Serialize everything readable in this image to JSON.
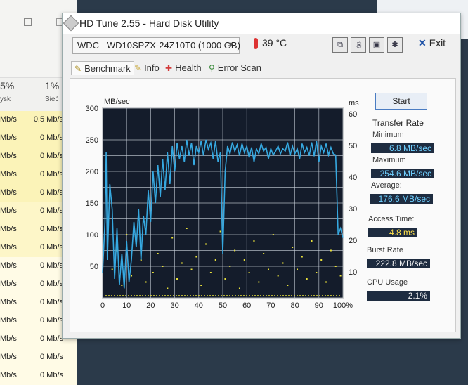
{
  "background_window": {
    "headers": [
      {
        "pct": "5%",
        "label": "ysk"
      },
      {
        "pct": "1%",
        "label": "Sieć"
      }
    ],
    "rows": [
      {
        "disk": "Mb/s",
        "net": "0,5 Mb/s"
      },
      {
        "disk": "Mb/s",
        "net": "0 Mb/s"
      },
      {
        "disk": "Mb/s",
        "net": "0 Mb/s"
      },
      {
        "disk": "Mb/s",
        "net": "0 Mb/s"
      },
      {
        "disk": "Mb/s",
        "net": "0 Mb/s"
      },
      {
        "disk": "Mb/s",
        "net": "0 Mb/s"
      },
      {
        "disk": "Mb/s",
        "net": "0 Mb/s"
      },
      {
        "disk": "Mb/s",
        "net": "0 Mb/s"
      },
      {
        "disk": "Mb/s",
        "net": "0 Mb/s"
      },
      {
        "disk": "Mb/s",
        "net": "0 Mb/s"
      },
      {
        "disk": "Mb/s",
        "net": "0 Mb/s"
      },
      {
        "disk": "Mb/s",
        "net": "0 Mb/s"
      },
      {
        "disk": "Mb/s",
        "net": "0 Mb/s"
      },
      {
        "disk": "Mb/s",
        "net": "0 Mb/s"
      },
      {
        "disk": "Mb/s",
        "net": "0 Mb/s"
      }
    ]
  },
  "window": {
    "title": "HD Tune 2.55 - Hard Disk Utility",
    "drive_vendor": "WDC",
    "drive_model": "WD10SPZX-24Z10T0 (1000 GB)",
    "temperature": "39 °C",
    "exit_label": "Exit"
  },
  "tabs": [
    {
      "label": "Benchmark",
      "icon": "benchmark-icon"
    },
    {
      "label": "Info",
      "icon": "info-icon"
    },
    {
      "label": "Health",
      "icon": "health-icon"
    },
    {
      "label": "Error Scan",
      "icon": "magnifier-icon"
    }
  ],
  "right_panel": {
    "start_label": "Start",
    "transfer_rate_title": "Transfer Rate",
    "minimum_label": "Minimum",
    "minimum_value": "6.8 MB/sec",
    "maximum_label": "Maximum",
    "maximum_value": "254.6 MB/sec",
    "average_label": "Average:",
    "average_value": "176.6 MB/sec",
    "access_time_label": "Access Time:",
    "access_time_value": "4.8 ms",
    "burst_rate_label": "Burst Rate",
    "burst_rate_value": "222.8 MB/sec",
    "cpu_usage_label": "CPU Usage",
    "cpu_usage_value": "2.1%"
  },
  "colors": {
    "plot_bg": "#141c2b",
    "grid": "#c8d0da",
    "transfer_line": "#36a9e1",
    "access_dots": "#e8e03a"
  },
  "chart_data": {
    "type": "line",
    "y_left_label": "MB/sec",
    "y_right_label": "ms",
    "x_ticks": [
      "0",
      "10",
      "20",
      "30",
      "40",
      "50",
      "60",
      "70",
      "80",
      "90",
      "100%"
    ],
    "y_left_ticks": [
      "300",
      "250",
      "200",
      "150",
      "100",
      "50"
    ],
    "y_right_ticks": [
      "60",
      "50",
      "40",
      "30",
      "20",
      "10"
    ],
    "xlim": [
      0,
      100
    ],
    "ylim_left": [
      0,
      300
    ],
    "ylim_right": [
      0,
      60
    ],
    "series": [
      {
        "values": [
          [
            0,
            40
          ],
          [
            1,
            120
          ],
          [
            1.5,
            230
          ],
          [
            2,
            60
          ],
          [
            3,
            180
          ],
          [
            4,
            140
          ],
          [
            5,
            30
          ],
          [
            6,
            110
          ],
          [
            7,
            20
          ],
          [
            8,
            70
          ],
          [
            9,
            15
          ],
          [
            10,
            90
          ],
          [
            11,
            25
          ],
          [
            12,
            60
          ],
          [
            13,
            120
          ],
          [
            14,
            80
          ],
          [
            15,
            140
          ],
          [
            16,
            60
          ],
          [
            17,
            130
          ],
          [
            18,
            100
          ],
          [
            19,
            170
          ],
          [
            20,
            120
          ],
          [
            21,
            200
          ],
          [
            22,
            150
          ],
          [
            23,
            210
          ],
          [
            24,
            160
          ],
          [
            25,
            220
          ],
          [
            26,
            170
          ],
          [
            27,
            230
          ],
          [
            28,
            180
          ],
          [
            29,
            240
          ],
          [
            30,
            200
          ],
          [
            31,
            245
          ],
          [
            32,
            220
          ],
          [
            33,
            240
          ],
          [
            34,
            215
          ],
          [
            35,
            250
          ],
          [
            36,
            225
          ],
          [
            37,
            245
          ],
          [
            38,
            210
          ],
          [
            39,
            240
          ],
          [
            40,
            230
          ],
          [
            41,
            248
          ],
          [
            42,
            225
          ],
          [
            43,
            250
          ],
          [
            44,
            235
          ],
          [
            45,
            245
          ],
          [
            46,
            220
          ],
          [
            47,
            248
          ],
          [
            48,
            215
          ],
          [
            49,
            230
          ],
          [
            50,
            70
          ],
          [
            51,
            200
          ],
          [
            52,
            240
          ],
          [
            53,
            228
          ],
          [
            54,
            246
          ],
          [
            55,
            232
          ],
          [
            56,
            242
          ],
          [
            57,
            225
          ],
          [
            58,
            244
          ],
          [
            59,
            230
          ],
          [
            60,
            240
          ],
          [
            61,
            222
          ],
          [
            62,
            238
          ],
          [
            63,
            215
          ],
          [
            64,
            236
          ],
          [
            65,
            228
          ],
          [
            66,
            244
          ],
          [
            67,
            232
          ],
          [
            68,
            238
          ],
          [
            69,
            220
          ],
          [
            70,
            236
          ],
          [
            71,
            226
          ],
          [
            72,
            232
          ],
          [
            73,
            240
          ],
          [
            74,
            228
          ],
          [
            75,
            236
          ],
          [
            76,
            232
          ],
          [
            77,
            246
          ],
          [
            78,
            225
          ],
          [
            79,
            240
          ],
          [
            80,
            228
          ],
          [
            81,
            236
          ],
          [
            82,
            220
          ],
          [
            83,
            244
          ],
          [
            84,
            230
          ],
          [
            85,
            238
          ],
          [
            86,
            225
          ],
          [
            87,
            246
          ],
          [
            88,
            224
          ],
          [
            89,
            248
          ],
          [
            90,
            215
          ],
          [
            91,
            240
          ],
          [
            92,
            230
          ],
          [
            93,
            244
          ],
          [
            94,
            226
          ],
          [
            95,
            238
          ],
          [
            96,
            228
          ],
          [
            97,
            226
          ],
          [
            98,
            100
          ],
          [
            99,
            110
          ],
          [
            100,
            95
          ]
        ]
      },
      {
        "type": "scatter",
        "values": [
          [
            2,
            25
          ],
          [
            4,
            9
          ],
          [
            6,
            15
          ],
          [
            8,
            4
          ],
          [
            10,
            20
          ],
          [
            12,
            7
          ],
          [
            14,
            18
          ],
          [
            16,
            12
          ],
          [
            18,
            5
          ],
          [
            20,
            26
          ],
          [
            21,
            8
          ],
          [
            23,
            14
          ],
          [
            25,
            10
          ],
          [
            27,
            3
          ],
          [
            29,
            19
          ],
          [
            31,
            6
          ],
          [
            33,
            11
          ],
          [
            35,
            22
          ],
          [
            37,
            9
          ],
          [
            39,
            13
          ],
          [
            41,
            4
          ],
          [
            43,
            17
          ],
          [
            45,
            8
          ],
          [
            47,
            12
          ],
          [
            49,
            21
          ],
          [
            51,
            6
          ],
          [
            53,
            10
          ],
          [
            55,
            15
          ],
          [
            57,
            3
          ],
          [
            59,
            12
          ],
          [
            61,
            8
          ],
          [
            63,
            18
          ],
          [
            65,
            5
          ],
          [
            67,
            14
          ],
          [
            69,
            9
          ],
          [
            71,
            20
          ],
          [
            73,
            7
          ],
          [
            75,
            11
          ],
          [
            77,
            4
          ],
          [
            79,
            16
          ],
          [
            81,
            9
          ],
          [
            83,
            13
          ],
          [
            85,
            6
          ],
          [
            87,
            18
          ],
          [
            89,
            8
          ],
          [
            91,
            12
          ],
          [
            93,
            5
          ],
          [
            95,
            15
          ],
          [
            97,
            10
          ],
          [
            99,
            7
          ]
        ]
      }
    ]
  }
}
